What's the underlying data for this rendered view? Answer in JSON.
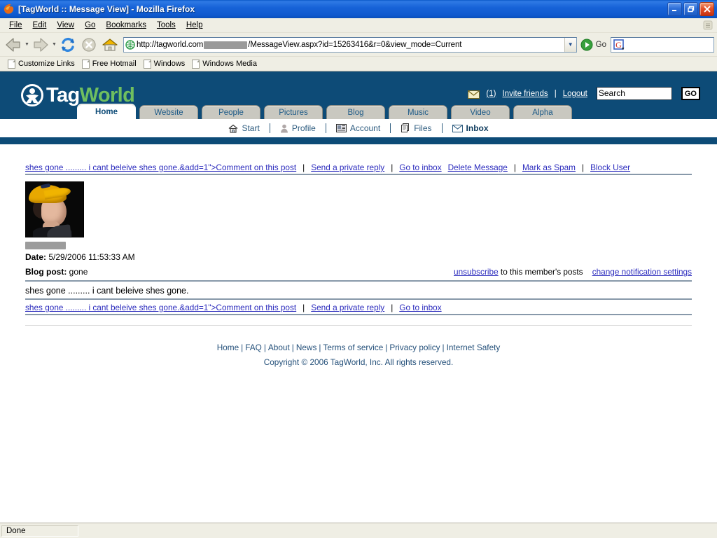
{
  "window": {
    "title": "[TagWorld :: Message View] - Mozilla Firefox",
    "minimize_label": "Minimize",
    "restore_label": "Restore",
    "close_label": "Close"
  },
  "menubar": {
    "items": [
      {
        "label": "File"
      },
      {
        "label": "Edit"
      },
      {
        "label": "View"
      },
      {
        "label": "Go"
      },
      {
        "label": "Bookmarks"
      },
      {
        "label": "Tools"
      },
      {
        "label": "Help"
      }
    ]
  },
  "toolbar": {
    "back_label": "Back",
    "forward_label": "Forward",
    "reload_label": "Reload",
    "stop_label": "Stop",
    "home_label": "Home",
    "url_prefix": "http://tagworld.com",
    "url_suffix": "/MessageView.aspx?id=15263416&r=0&view_mode=Current",
    "go_label": "Go",
    "browser_search_value": ""
  },
  "bookmarks": {
    "items": [
      {
        "label": "Customize Links"
      },
      {
        "label": "Free Hotmail"
      },
      {
        "label": "Windows"
      },
      {
        "label": "Windows Media"
      }
    ]
  },
  "site": {
    "logo_tag": "Tag",
    "logo_world": "World",
    "header_bg": "#0d4b77",
    "accent_green": "#6fbf5f",
    "link_color": "#2b2bbd",
    "top_right": {
      "mail_count": "(1)",
      "invite_label": "Invite friends",
      "separator": "|",
      "logout_label": "Logout",
      "search_value": "Search",
      "go_label": "GO"
    },
    "tabs": [
      {
        "label": "Home",
        "active": true
      },
      {
        "label": "Website",
        "active": false
      },
      {
        "label": "People",
        "active": false
      },
      {
        "label": "Pictures",
        "active": false
      },
      {
        "label": "Blog",
        "active": false
      },
      {
        "label": "Music",
        "active": false
      },
      {
        "label": "Video",
        "active": false
      },
      {
        "label": "Alpha",
        "active": false
      }
    ],
    "subnav": [
      {
        "label": "Start",
        "icon": "house-icon",
        "active": false
      },
      {
        "label": "Profile",
        "icon": "person-icon",
        "active": false
      },
      {
        "label": "Account",
        "icon": "card-icon",
        "active": false
      },
      {
        "label": "Files",
        "icon": "documents-icon",
        "active": false
      },
      {
        "label": "Inbox",
        "icon": "envelope-icon",
        "active": true
      }
    ]
  },
  "message": {
    "top_links": {
      "comment": "shes gone ......... i cant beleive shes gone.&add=1\">Comment on this post",
      "private_reply": "Send a private reply",
      "go_to_inbox": "Go to inbox",
      "delete": "Delete Message",
      "spam": "Mark as Spam",
      "block": "Block User",
      "separator": "|"
    },
    "date_label": "Date:",
    "date_value": "5/29/2006 11:53:33 AM",
    "blog_label": "Blog post:",
    "blog_value": "gone",
    "unsubscribe_link": "unsubscribe",
    "unsubscribe_text": "to this member's posts",
    "notification_link": "change notification settings",
    "body": "shes gone ......... i cant beleive shes gone.",
    "bottom_links": {
      "comment": "shes gone ......... i cant beleive shes gone.&add=1\">Comment on this post",
      "private_reply": "Send a private reply",
      "go_to_inbox": "Go to inbox",
      "separator": "|"
    }
  },
  "footer": {
    "links": [
      "Home",
      "FAQ",
      "About",
      "News",
      "Terms of service",
      "Privacy policy",
      "Internet Safety"
    ],
    "separator": "|",
    "copyright": "Copyright © 2006 TagWorld, Inc. All rights reserved."
  },
  "statusbar": {
    "text": "Done"
  }
}
